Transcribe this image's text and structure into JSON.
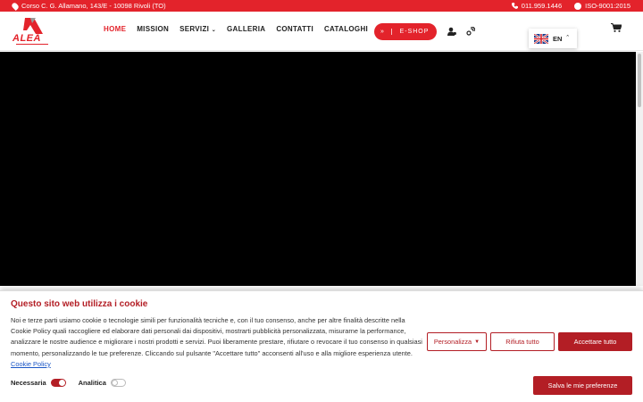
{
  "topbar": {
    "address": "Corso C. G. Allamano, 143/E - 10098 Rivoli (TO)",
    "phone": "011.959.1446",
    "certification": "ISO-9001:2015"
  },
  "header": {
    "logo_text": "ALEA",
    "nav": [
      {
        "label": "HOME",
        "active": true
      },
      {
        "label": "MISSION",
        "active": false
      },
      {
        "label": "SERVIZI",
        "active": false
      },
      {
        "label": "GALLERIA",
        "active": false
      },
      {
        "label": "CONTATTI",
        "active": false
      },
      {
        "label": "CATALOGHI",
        "active": false
      }
    ],
    "eshop_label": "E-SHOP",
    "language": "EN"
  },
  "cookie": {
    "title": "Questo sito web utilizza i cookie",
    "description": "Noi e terze parti usiamo cookie o tecnologie simili per funzionalità tecniche e, con il tuo consenso, anche per altre finalità descritte nella Cookie Policy quali raccogliere ed elaborare dati personali dai dispositivi, mostrarti pubblicità personalizzata, misurarne la performance, analizzare le nostre audience e migliorare i nostri prodotti e servizi. Puoi liberamente prestare, rifiutare o revocare il tuo consenso in qualsiasi momento, personalizzando le tue preferenze. Cliccando sul pulsante \"Accettare tutto\" acconsenti all'uso e alla migliore esperienza utente.",
    "policy_link": "Cookie Policy",
    "customize_label": "Personalizza",
    "reject_label": "Rifiuta tutto",
    "accept_label": "Accettare tutto",
    "save_label": "Salva le mie preferenze",
    "toggles": [
      {
        "label": "Necessaria",
        "on": true
      },
      {
        "label": "Analitica",
        "on": false
      }
    ]
  },
  "colors": {
    "brand_red": "#e3232b",
    "cookie_red": "#b31e25"
  }
}
